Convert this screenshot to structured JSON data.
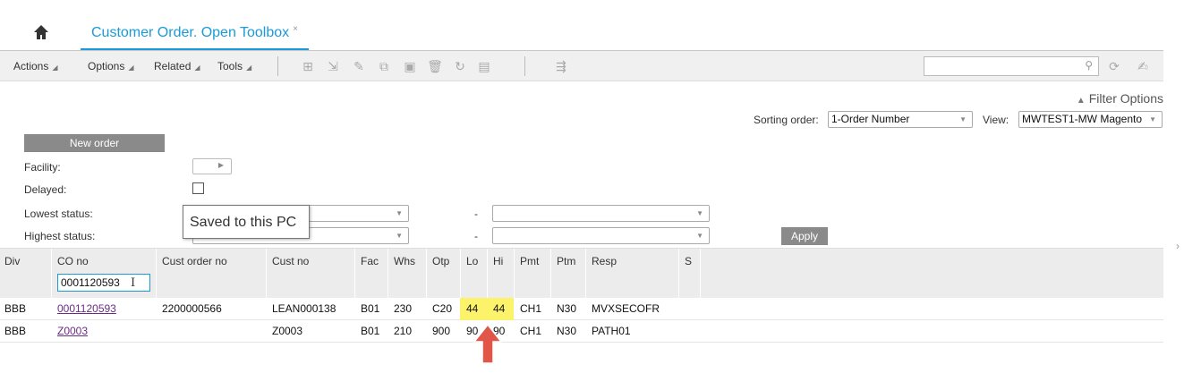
{
  "tab": {
    "title": "Customer Order. Open Toolbox",
    "close": "×"
  },
  "toolbar": {
    "menus": [
      "Actions",
      "Options",
      "Related",
      "Tools"
    ],
    "search_value": ""
  },
  "filter": {
    "filter_options_label": "Filter Options",
    "sorting_order_label": "Sorting order:",
    "sorting_order_value": "1-Order Number",
    "view_label": "View:",
    "view_value": "MWTEST1-MW Magento",
    "new_order_label": "New order",
    "facility_label": "Facility:",
    "delayed_label": "Delayed:",
    "lowest_status_label": "Lowest status:",
    "highest_status_label": "Highest status:",
    "range_dash": "-",
    "apply_label": "Apply",
    "tooltip": "Saved to this PC"
  },
  "table": {
    "headers": [
      "Div",
      "CO no",
      "Cust order no",
      "Cust no",
      "Fac",
      "Whs",
      "Otp",
      "Lo",
      "Hi",
      "Pmt",
      "Ptm",
      "Resp",
      "S"
    ],
    "co_no_filter": "0001120593",
    "rows": [
      {
        "div": "BBB",
        "co_no": "0001120593",
        "cust_order_no": "2200000566",
        "cust_no": "LEAN000138",
        "fac": "B01",
        "whs": "230",
        "otp": "C20",
        "lo": "44",
        "hi": "44",
        "pmt": "CH1",
        "ptm": "N30",
        "resp": "MVXSECOFR",
        "s": ""
      },
      {
        "div": "BBB",
        "co_no": "Z0003",
        "cust_order_no": "",
        "cust_no": "Z0003",
        "fac": "B01",
        "whs": "210",
        "otp": "900",
        "lo": "90",
        "hi": "90",
        "pmt": "CH1",
        "ptm": "N30",
        "resp": "PATH01",
        "s": ""
      }
    ]
  },
  "colors": {
    "accent": "#1a9ad6",
    "highlight": "#fdf36a",
    "arrow": "#e0574a",
    "link": "#6b2c86"
  }
}
